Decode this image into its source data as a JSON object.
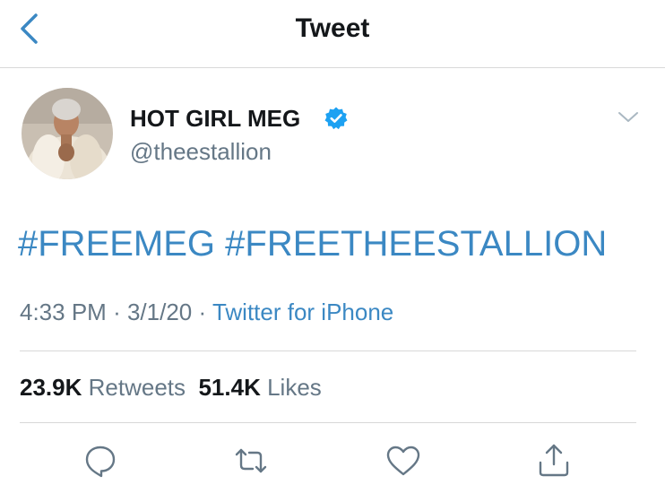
{
  "nav": {
    "title": "Tweet"
  },
  "tweet": {
    "author": {
      "display_name": "HOT GIRL MEG",
      "handle": "@theestallion",
      "verified": true
    },
    "hashtags": [
      "#FREEMEG",
      "#FREETHEESTALLION"
    ],
    "time": "4:33 PM",
    "date": "3/1/20",
    "separator": "·",
    "source": "Twitter for iPhone",
    "retweets_count": "23.9K",
    "retweets_label": "Retweets",
    "likes_count": "51.4K",
    "likes_label": "Likes"
  },
  "colors": {
    "link_blue": "#3b88c3",
    "verified_blue": "#1da1f2",
    "muted_gray": "#657786",
    "divider": "#d8d8d8"
  },
  "icons": {
    "back": "chevron-left-icon",
    "verified": "verified-badge-icon",
    "more": "chevron-down-icon",
    "reply": "reply-icon",
    "retweet": "retweet-icon",
    "like": "heart-icon",
    "share": "share-icon"
  }
}
